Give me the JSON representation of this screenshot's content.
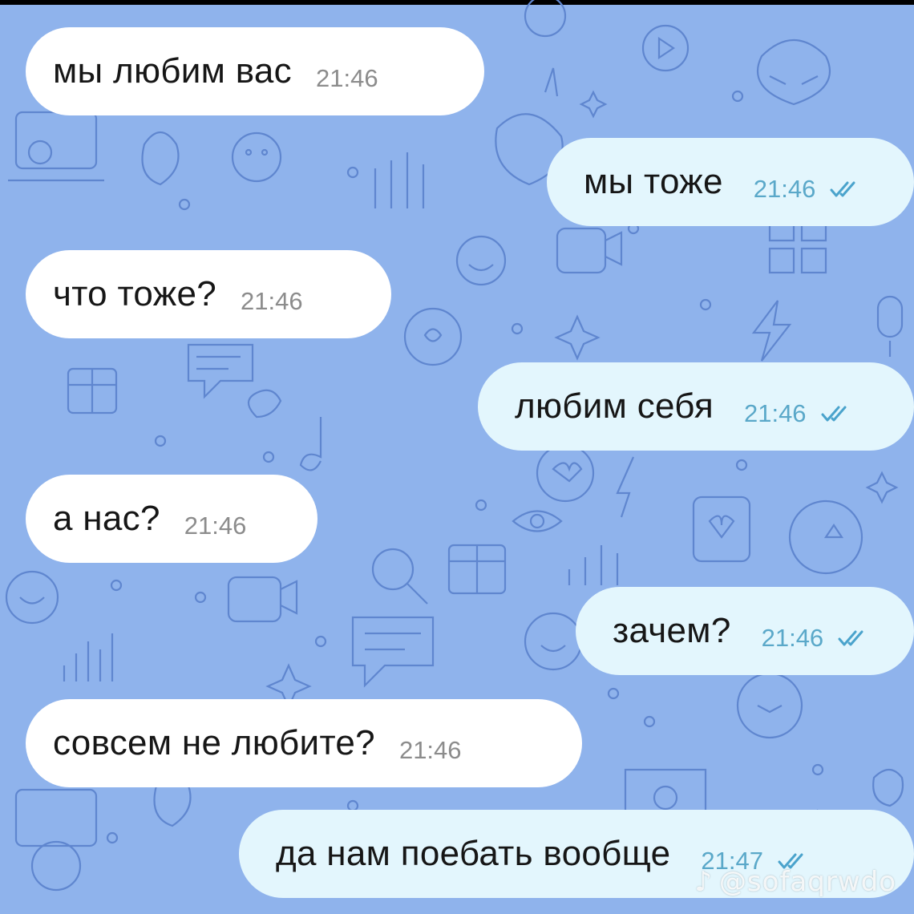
{
  "chat": {
    "messages": [
      {
        "direction": "incoming",
        "text": "мы любим вас",
        "time": "21:46"
      },
      {
        "direction": "outgoing",
        "text": "мы тоже",
        "time": "21:46",
        "status": "read"
      },
      {
        "direction": "incoming",
        "text": "что тоже?",
        "time": "21:46"
      },
      {
        "direction": "outgoing",
        "text": "любим себя",
        "time": "21:46",
        "status": "read"
      },
      {
        "direction": "incoming",
        "text": "а нас?",
        "time": "21:46"
      },
      {
        "direction": "outgoing",
        "text": "зачем?",
        "time": "21:46",
        "status": "read"
      },
      {
        "direction": "incoming",
        "text": "совсем не любите?",
        "time": "21:46"
      },
      {
        "direction": "outgoing",
        "text": "да нам поебать вообще",
        "time": "21:47",
        "status": "read"
      }
    ]
  },
  "watermark": {
    "icon": "tiktok-note-icon",
    "handle": "@sofaqrwdo"
  },
  "colors": {
    "wallpaper": "#8fb3ec",
    "incoming_bubble": "#ffffff",
    "outgoing_bubble": "#e3f6fd",
    "read_check": "#4aa3cc"
  }
}
